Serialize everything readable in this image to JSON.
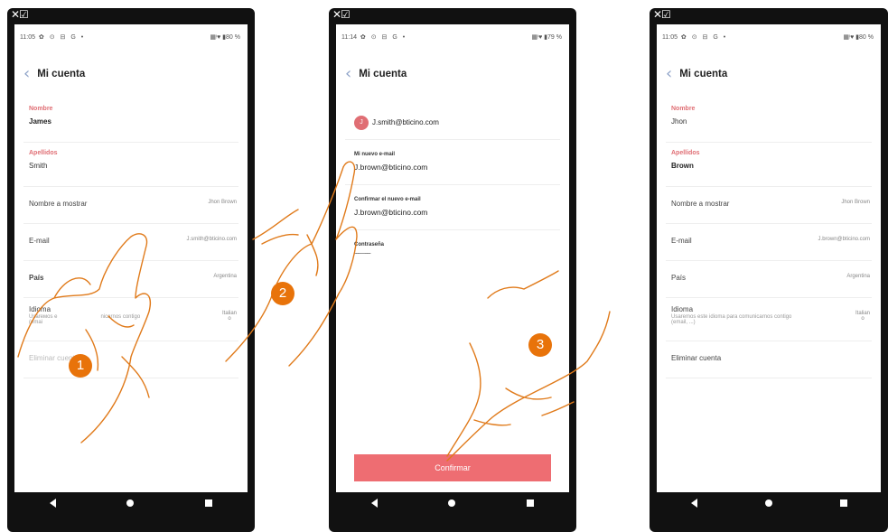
{
  "phones": [
    {
      "status": {
        "time": "11:05",
        "icons": "✿ ⊙ ⊟ G •",
        "battery": "80 %"
      },
      "header": {
        "title": "Mi cuenta"
      },
      "fields": [
        {
          "label": "Nombre",
          "value": "James"
        },
        {
          "label": "Apellidos",
          "value": "Smith"
        }
      ],
      "rows": {
        "display_name": {
          "label": "Nombre a mostrar",
          "value": "Jhon Brown"
        },
        "email": {
          "label": "E-mail",
          "value": "J.smith@bticino.com"
        },
        "country": {
          "label": "País",
          "value": "Argentina"
        },
        "language": {
          "label": "Idioma",
          "sub": "Usareмos e",
          "sub2": "(emai",
          "sub_right": "nicarnos contigo",
          "value": "Italian",
          "value2": "o"
        },
        "delete": {
          "label": "Eliminar cuenta"
        }
      }
    },
    {
      "status": {
        "time": "11:14",
        "icons": "✿ ⊙ ⊟ G •",
        "battery": "79 %"
      },
      "header": {
        "title": "Mi cuenta"
      },
      "avatar_letter": "J",
      "current_email": "J.smith@bticino.com",
      "new_email": {
        "label": "Mi nuevo e-mail",
        "value": "J.brown@bticino.com"
      },
      "confirm_email": {
        "label": "Confirmar el nuevo e-mail",
        "value": "J.brown@bticino.com"
      },
      "password": {
        "label": "Contraseña",
        "value": "..................."
      },
      "confirm_button": "Confirmar"
    },
    {
      "status": {
        "time": "11:05",
        "icons": "✿ ⊙ ⊟ G •",
        "battery": "80 %"
      },
      "header": {
        "title": "Mi cuenta"
      },
      "fields": [
        {
          "label": "Nombre",
          "value": "Jhon"
        },
        {
          "label": "Apellidos",
          "value": "Brown"
        }
      ],
      "rows": {
        "display_name": {
          "label": "Nombre a mostrar",
          "value": "Jhon Brown"
        },
        "email": {
          "label": "E-mail",
          "value": "J.brown@bticino.com"
        },
        "country": {
          "label": "País",
          "value": "Argentina"
        },
        "language": {
          "label": "Idioma",
          "sub": "Usaremos este idioma para comunicarnos contigo",
          "sub2": "(email, ...)",
          "value": "Italian",
          "value2": "o"
        },
        "delete": {
          "label": "Eliminar cuenta"
        }
      }
    }
  ],
  "corner_icon": "✕☑",
  "step_badges": [
    "1",
    "2",
    "3"
  ],
  "colors": {
    "accent": "#e06e74",
    "button": "#ee6d72",
    "badge": "#e8730a",
    "hand": "#e07a1a"
  }
}
